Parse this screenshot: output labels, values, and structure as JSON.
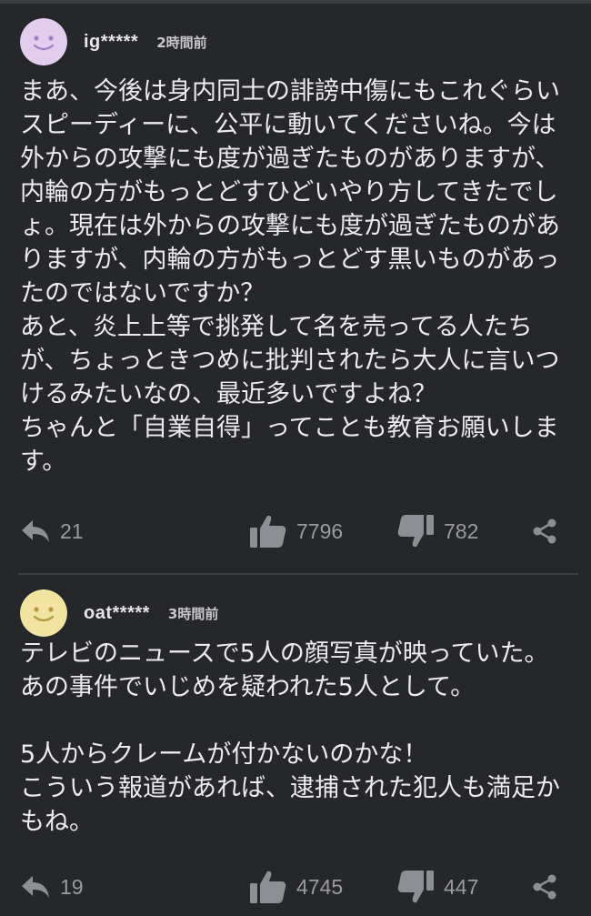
{
  "comments": [
    {
      "avatar_color": "#e3cdef",
      "avatar_face_color": "#a77fc0",
      "username": "ig*****",
      "timestamp": "2時間前",
      "body": "まあ、今後は身内同士の誹謗中傷にもこれぐらいスピーディーに、公平に動いてくださいね。今は外からの攻撃にも度が過ぎたものがありますが、内輪の方がもっとどすひどいやり方してきたでしょ。現在は外からの攻撃にも度が過ぎたものがありますが、内輪の方がもっとどす黒いものがあったのではないですか？\nあと、炎上上等で挑発して名を売ってる人たちが、ちょっときつめに批判されたら大人に言いつけるみたいなの、最近多いですよね？\nちゃんと「自業自得」ってことも教育お願いします。",
      "reply_count": "21",
      "like_count": "7796",
      "dislike_count": "782"
    },
    {
      "avatar_color": "#f3e3a1",
      "avatar_face_color": "#b39a3d",
      "username": "oat*****",
      "timestamp": "3時間前",
      "body": "テレビのニュースで5人の顔写真が映っていた。\nあの事件でいじめを疑われた5人として。\n\n5人からクレームが付かないのかな！\nこういう報道があれば、逮捕された犯人も満足かもね。",
      "reply_count": "19",
      "like_count": "4745",
      "dislike_count": "447"
    }
  ],
  "icons": {
    "reply": "reply-arrow-icon",
    "like": "thumbs-up-icon",
    "dislike": "thumbs-down-icon",
    "share": "share-icon"
  },
  "colors": {
    "background": "#26272b",
    "text": "#ececee",
    "muted": "#9a9ba0"
  }
}
